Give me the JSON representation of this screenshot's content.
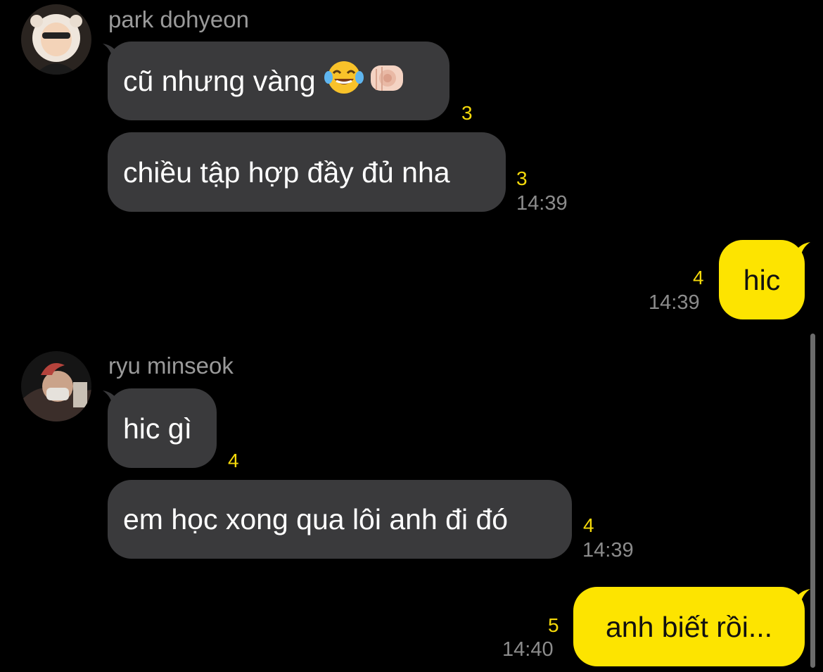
{
  "chat": {
    "group1": {
      "sender": "park dohyeon",
      "avatar_icon": "user-avatar-park-dohyeon",
      "msg1": {
        "text": "cũ nhưng vàng",
        "emoji": [
          "face-with-tears-of-joy",
          "backhand-index-pointing-at-viewer"
        ],
        "unread": "3"
      },
      "msg2": {
        "text": "chiều tập hợp đầy đủ nha",
        "unread": "3",
        "time": "14:39"
      }
    },
    "outgoing1": {
      "text": "hic",
      "unread": "4",
      "time": "14:39"
    },
    "group2": {
      "sender": "ryu minseok",
      "avatar_icon": "user-avatar-ryu-minseok",
      "msg1": {
        "text": "hic gì",
        "unread": "4"
      },
      "msg2": {
        "text": "em học xong qua lôi anh đi đó",
        "unread": "4",
        "time": "14:39"
      }
    },
    "outgoing2": {
      "text": "anh biết rồi...",
      "unread": "5",
      "time": "14:40"
    }
  },
  "colors": {
    "background": "#000000",
    "incoming_bubble": "#3a3a3c",
    "outgoing_bubble": "#fde400",
    "unread_count": "#f5d90a",
    "timestamp": "#8c8c8c",
    "sender_name": "#9a9a9a"
  }
}
